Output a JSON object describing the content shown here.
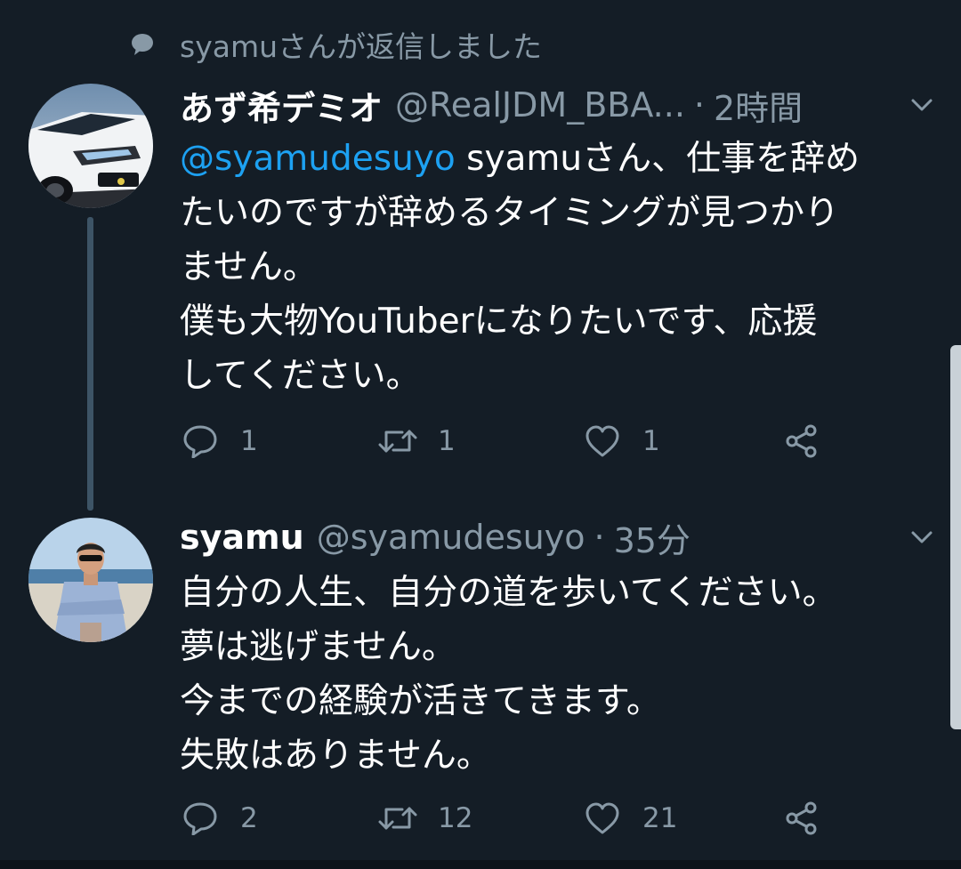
{
  "context": {
    "icon": "speech-bubble-icon",
    "text": "syamuさんが返信しました"
  },
  "colors": {
    "background": "#141d26",
    "secondary_text": "#8899a6",
    "mention": "#1da1f2",
    "thread_line": "#3d5466"
  },
  "tweets": [
    {
      "avatar": "white-car-avatar",
      "name": "あず希デミオ",
      "handle": "@RealJDM_BBA...",
      "separator": "·",
      "time": "2時間",
      "body": {
        "mention": "@syamudesuyo",
        "line1_rest": " syamuさん、仕事を辞め",
        "line2": "たいのですが辞めるタイミングが見つかり",
        "line3": "ません。",
        "line4": "僕も大物YouTuberになりたいです、応援",
        "line5": "してください。"
      },
      "actions": {
        "reply_icon": "reply-icon",
        "reply_count": "1",
        "retweet_icon": "retweet-icon",
        "retweet_count": "1",
        "like_icon": "heart-icon",
        "like_count": "1",
        "share_icon": "share-icon"
      }
    },
    {
      "avatar": "man-sunglasses-beach-avatar",
      "name": "syamu",
      "handle": "@syamudesuyo",
      "separator": "·",
      "time": "35分",
      "body": {
        "line1": "自分の人生、自分の道を歩いてください。",
        "line2": "夢は逃げません。",
        "line3": "今までの経験が活きてきます。",
        "line4": "失敗はありません。"
      },
      "actions": {
        "reply_icon": "reply-icon",
        "reply_count": "2",
        "retweet_icon": "retweet-icon",
        "retweet_count": "12",
        "like_icon": "heart-icon",
        "like_count": "21",
        "share_icon": "share-icon"
      }
    }
  ]
}
